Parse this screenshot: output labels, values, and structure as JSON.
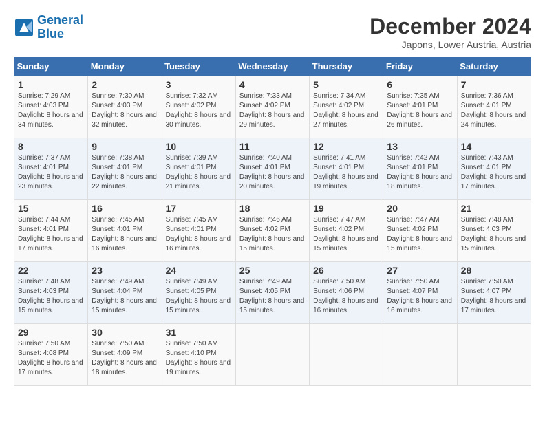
{
  "logo": {
    "text_general": "General",
    "text_blue": "Blue"
  },
  "header": {
    "title": "December 2024",
    "subtitle": "Japons, Lower Austria, Austria"
  },
  "days_of_week": [
    "Sunday",
    "Monday",
    "Tuesday",
    "Wednesday",
    "Thursday",
    "Friday",
    "Saturday"
  ],
  "weeks": [
    [
      {
        "day": "1",
        "sunrise": "Sunrise: 7:29 AM",
        "sunset": "Sunset: 4:03 PM",
        "daylight": "Daylight: 8 hours and 34 minutes."
      },
      {
        "day": "2",
        "sunrise": "Sunrise: 7:30 AM",
        "sunset": "Sunset: 4:03 PM",
        "daylight": "Daylight: 8 hours and 32 minutes."
      },
      {
        "day": "3",
        "sunrise": "Sunrise: 7:32 AM",
        "sunset": "Sunset: 4:02 PM",
        "daylight": "Daylight: 8 hours and 30 minutes."
      },
      {
        "day": "4",
        "sunrise": "Sunrise: 7:33 AM",
        "sunset": "Sunset: 4:02 PM",
        "daylight": "Daylight: 8 hours and 29 minutes."
      },
      {
        "day": "5",
        "sunrise": "Sunrise: 7:34 AM",
        "sunset": "Sunset: 4:02 PM",
        "daylight": "Daylight: 8 hours and 27 minutes."
      },
      {
        "day": "6",
        "sunrise": "Sunrise: 7:35 AM",
        "sunset": "Sunset: 4:01 PM",
        "daylight": "Daylight: 8 hours and 26 minutes."
      },
      {
        "day": "7",
        "sunrise": "Sunrise: 7:36 AM",
        "sunset": "Sunset: 4:01 PM",
        "daylight": "Daylight: 8 hours and 24 minutes."
      }
    ],
    [
      {
        "day": "8",
        "sunrise": "Sunrise: 7:37 AM",
        "sunset": "Sunset: 4:01 PM",
        "daylight": "Daylight: 8 hours and 23 minutes."
      },
      {
        "day": "9",
        "sunrise": "Sunrise: 7:38 AM",
        "sunset": "Sunset: 4:01 PM",
        "daylight": "Daylight: 8 hours and 22 minutes."
      },
      {
        "day": "10",
        "sunrise": "Sunrise: 7:39 AM",
        "sunset": "Sunset: 4:01 PM",
        "daylight": "Daylight: 8 hours and 21 minutes."
      },
      {
        "day": "11",
        "sunrise": "Sunrise: 7:40 AM",
        "sunset": "Sunset: 4:01 PM",
        "daylight": "Daylight: 8 hours and 20 minutes."
      },
      {
        "day": "12",
        "sunrise": "Sunrise: 7:41 AM",
        "sunset": "Sunset: 4:01 PM",
        "daylight": "Daylight: 8 hours and 19 minutes."
      },
      {
        "day": "13",
        "sunrise": "Sunrise: 7:42 AM",
        "sunset": "Sunset: 4:01 PM",
        "daylight": "Daylight: 8 hours and 18 minutes."
      },
      {
        "day": "14",
        "sunrise": "Sunrise: 7:43 AM",
        "sunset": "Sunset: 4:01 PM",
        "daylight": "Daylight: 8 hours and 17 minutes."
      }
    ],
    [
      {
        "day": "15",
        "sunrise": "Sunrise: 7:44 AM",
        "sunset": "Sunset: 4:01 PM",
        "daylight": "Daylight: 8 hours and 17 minutes."
      },
      {
        "day": "16",
        "sunrise": "Sunrise: 7:45 AM",
        "sunset": "Sunset: 4:01 PM",
        "daylight": "Daylight: 8 hours and 16 minutes."
      },
      {
        "day": "17",
        "sunrise": "Sunrise: 7:45 AM",
        "sunset": "Sunset: 4:01 PM",
        "daylight": "Daylight: 8 hours and 16 minutes."
      },
      {
        "day": "18",
        "sunrise": "Sunrise: 7:46 AM",
        "sunset": "Sunset: 4:02 PM",
        "daylight": "Daylight: 8 hours and 15 minutes."
      },
      {
        "day": "19",
        "sunrise": "Sunrise: 7:47 AM",
        "sunset": "Sunset: 4:02 PM",
        "daylight": "Daylight: 8 hours and 15 minutes."
      },
      {
        "day": "20",
        "sunrise": "Sunrise: 7:47 AM",
        "sunset": "Sunset: 4:02 PM",
        "daylight": "Daylight: 8 hours and 15 minutes."
      },
      {
        "day": "21",
        "sunrise": "Sunrise: 7:48 AM",
        "sunset": "Sunset: 4:03 PM",
        "daylight": "Daylight: 8 hours and 15 minutes."
      }
    ],
    [
      {
        "day": "22",
        "sunrise": "Sunrise: 7:48 AM",
        "sunset": "Sunset: 4:03 PM",
        "daylight": "Daylight: 8 hours and 15 minutes."
      },
      {
        "day": "23",
        "sunrise": "Sunrise: 7:49 AM",
        "sunset": "Sunset: 4:04 PM",
        "daylight": "Daylight: 8 hours and 15 minutes."
      },
      {
        "day": "24",
        "sunrise": "Sunrise: 7:49 AM",
        "sunset": "Sunset: 4:05 PM",
        "daylight": "Daylight: 8 hours and 15 minutes."
      },
      {
        "day": "25",
        "sunrise": "Sunrise: 7:49 AM",
        "sunset": "Sunset: 4:05 PM",
        "daylight": "Daylight: 8 hours and 15 minutes."
      },
      {
        "day": "26",
        "sunrise": "Sunrise: 7:50 AM",
        "sunset": "Sunset: 4:06 PM",
        "daylight": "Daylight: 8 hours and 16 minutes."
      },
      {
        "day": "27",
        "sunrise": "Sunrise: 7:50 AM",
        "sunset": "Sunset: 4:07 PM",
        "daylight": "Daylight: 8 hours and 16 minutes."
      },
      {
        "day": "28",
        "sunrise": "Sunrise: 7:50 AM",
        "sunset": "Sunset: 4:07 PM",
        "daylight": "Daylight: 8 hours and 17 minutes."
      }
    ],
    [
      {
        "day": "29",
        "sunrise": "Sunrise: 7:50 AM",
        "sunset": "Sunset: 4:08 PM",
        "daylight": "Daylight: 8 hours and 17 minutes."
      },
      {
        "day": "30",
        "sunrise": "Sunrise: 7:50 AM",
        "sunset": "Sunset: 4:09 PM",
        "daylight": "Daylight: 8 hours and 18 minutes."
      },
      {
        "day": "31",
        "sunrise": "Sunrise: 7:50 AM",
        "sunset": "Sunset: 4:10 PM",
        "daylight": "Daylight: 8 hours and 19 minutes."
      },
      null,
      null,
      null,
      null
    ]
  ]
}
